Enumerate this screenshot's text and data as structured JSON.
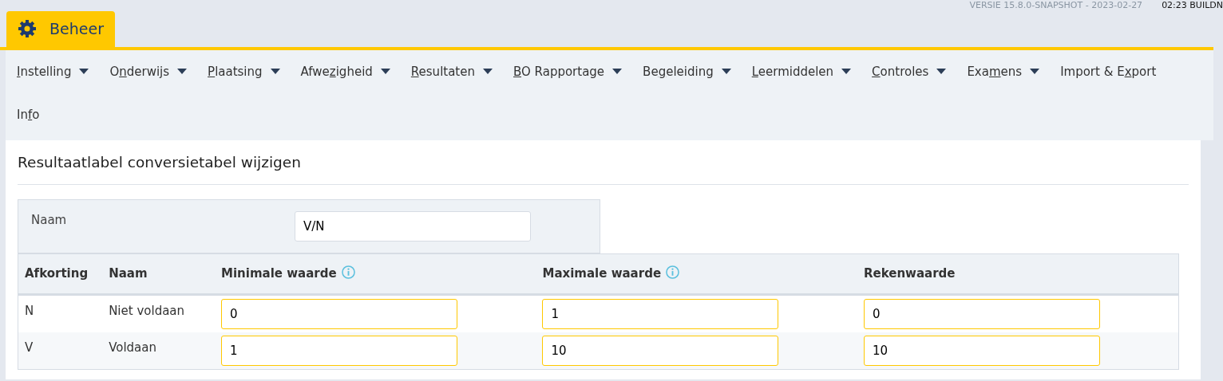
{
  "header": {
    "version": "VERSIE 15.8.0-SNAPSHOT - 2023-02-27",
    "build": "02:23 BUILDN"
  },
  "tabs": [
    {
      "label": "Beheer",
      "selected": true
    }
  ],
  "menu": [
    {
      "key": "I",
      "after": "nstelling",
      "dropdown": true
    },
    {
      "before": "O",
      "key": "n",
      "after": "derwijs",
      "dropdown": true
    },
    {
      "key": "P",
      "after": "laatsing",
      "dropdown": true
    },
    {
      "before": "Afwe",
      "key": "z",
      "after": "igheid",
      "dropdown": true
    },
    {
      "key": "R",
      "after": "esultaten",
      "dropdown": true
    },
    {
      "key": "B",
      "after": "O Rapportage",
      "dropdown": true
    },
    {
      "before": "Be",
      "key": "g",
      "after": "eleiding",
      "dropdown": true
    },
    {
      "key": "L",
      "after": "eermiddelen",
      "dropdown": true
    },
    {
      "key": "C",
      "after": "ontroles",
      "dropdown": true
    },
    {
      "before": "Exa",
      "key": "m",
      "after": "ens",
      "dropdown": true
    },
    {
      "before": "Import & E",
      "key": "x",
      "after": "port",
      "dropdown": false
    },
    {
      "before": "In",
      "key": "f",
      "after": "o",
      "dropdown": false
    }
  ],
  "page_title": "Resultaatlabel conversietabel wijzigen",
  "name_field": {
    "label": "Naam",
    "value": "V/N"
  },
  "table": {
    "columns": [
      {
        "label": "Afkorting",
        "info": false
      },
      {
        "label": "Naam",
        "info": false
      },
      {
        "label": "Minimale waarde",
        "info": true
      },
      {
        "label": "Maximale waarde",
        "info": true
      },
      {
        "label": "Rekenwaarde",
        "info": false
      }
    ],
    "rows": [
      {
        "afkorting": "N",
        "naam": "Niet voldaan",
        "min": "0",
        "max": "1",
        "reken": "0"
      },
      {
        "afkorting": "V",
        "naam": "Voldaan",
        "min": "1",
        "max": "10",
        "reken": "10"
      }
    ]
  }
}
